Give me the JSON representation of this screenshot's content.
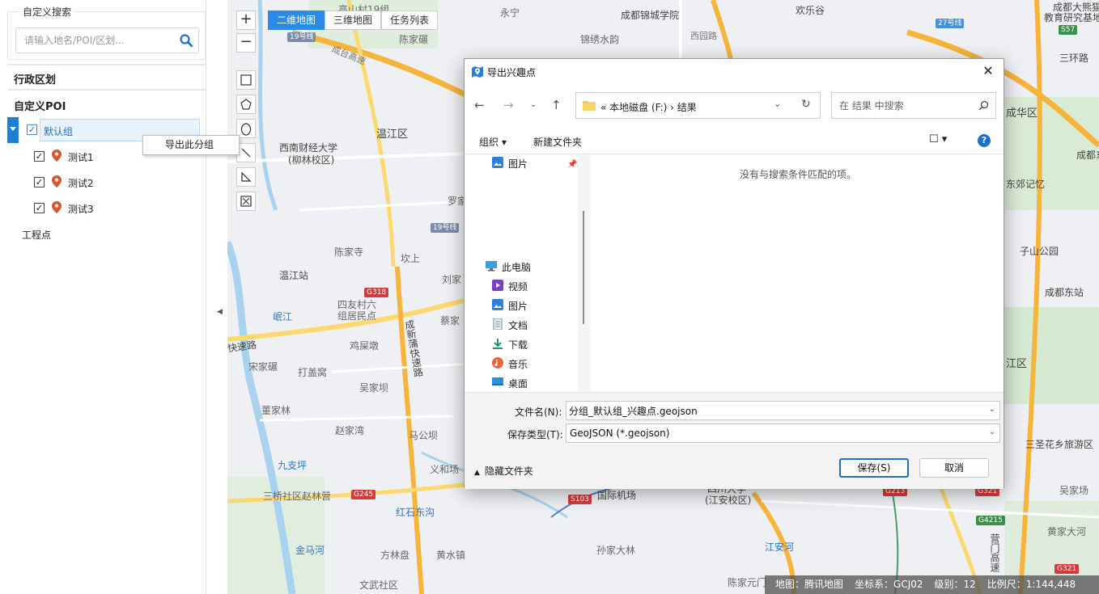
{
  "left_panel": {
    "search_legend": "自定义搜索",
    "search_placeholder": "请输入地名/POI/区划...",
    "section_admin": "行政区划",
    "section_poi": "自定义POI",
    "group_name": "默认组",
    "items": [
      {
        "label": "测试1",
        "checked": true
      },
      {
        "label": "测试2",
        "checked": true
      },
      {
        "label": "测试3",
        "checked": true
      }
    ],
    "project_points": "工程点",
    "context_menu_item": "导出此分组"
  },
  "map": {
    "tabs": [
      "二维地图",
      "三维地图",
      "任务列表"
    ],
    "active_tab": "二维地图",
    "zoom_in": "+",
    "zoom_out": "−",
    "labels": {
      "yongning": "永宁",
      "jinxiu": "锦绣水韵",
      "jinchengxy": "成都锦城学院",
      "huanlegu": "欢乐谷",
      "xiyuan": "西园路",
      "chenjiachang": "陈家碾",
      "gaoshancun": "高山村19组",
      "chenghewai": "成台高速",
      "wenjiangqu": "温江区",
      "xncjdx": "西南财经大学",
      "liulin": "(柳林校区)",
      "luojia": "罗家",
      "chenjiasi": "陈家寺",
      "kanshang": "坎上",
      "wenjiangzhan": "温江站",
      "liujia": "刘家",
      "siyoucun": "四友村六",
      "zujumin": "组居民点",
      "caijia": "蔡家",
      "minjiang": "岷江",
      "kuaisulu": "快速路",
      "cxpkz": "成新蒲快速路",
      "songjia": "宋家碾",
      "dinggai": "打盖窝",
      "jiequan": "鸡屎墩",
      "wujiaba": "吴家坝",
      "dongjialin": "董家林",
      "zhaojiawan": "赵家湾",
      "maogonglin": "马公坝",
      "jiuwenpin": "九支坪",
      "yihegu": "义和场",
      "sanqiao": "三桥社区赵林营",
      "hongshi": "红石东沟",
      "jinmahe": "金马河",
      "fanglinpan": "方林盘",
      "huangshuizhen": "黄水镇",
      "wenjiaoyuan": "文武社区",
      "guojijichang": "国际机场",
      "sunjiadalin": "孙家大林",
      "sichuandaxue": "四川大学",
      "jiangan": "(江安校区)",
      "jianganhe": "江安河",
      "chenjiayuan": "陈家元门",
      "chenghuaqu": "成华区",
      "dongjiaoji": "东郊记忆",
      "chengdudong": "成都东站",
      "zishan": "子山公园",
      "sanhuanlu": "三环路",
      "jinjiang": "江区",
      "sansheng": "三圣花乡旅游区",
      "wujiachang": "吴家场",
      "huangjiadahe": "黄家大河",
      "chengdudt": "成都东",
      "jiaoyu": "教育研究基地",
      "chengdudabai": "成都大熊猫",
      "yingmenkou": "营门高速"
    },
    "shields": [
      "19号线",
      "19号线",
      "27号线",
      "S57",
      "G318",
      "G245",
      "S103",
      "G213",
      "G321",
      "G4215",
      "G321"
    ],
    "status": {
      "map": "地图：腾讯地图",
      "crs": "坐标系：GCJ02",
      "level": "级别：12",
      "scale": "比例尺：1:144,448"
    }
  },
  "dialog": {
    "title": "导出兴趣点",
    "address": "«  本地磁盘 (F:)  ›  结果",
    "search_placeholder": "在 结果 中搜索",
    "organize": "组织 ▾",
    "new_folder": "新建文件夹",
    "help": "?",
    "nav_items": [
      {
        "label": "图片",
        "icon": "pictures-icon"
      },
      {
        "label": "此电脑",
        "icon": "computer-icon"
      },
      {
        "label": "视频",
        "icon": "video-icon"
      },
      {
        "label": "图片",
        "icon": "pictures-icon"
      },
      {
        "label": "文档",
        "icon": "documents-icon"
      },
      {
        "label": "下载",
        "icon": "download-icon"
      },
      {
        "label": "音乐",
        "icon": "music-icon"
      },
      {
        "label": "桌面",
        "icon": "desktop-icon"
      }
    ],
    "empty_message": "没有与搜索条件匹配的项。",
    "filename_label": "文件名(N):",
    "filename_value": "分组_默认组_兴趣点.geojson",
    "filetype_label": "保存类型(T):",
    "filetype_value": "GeoJSON (*.geojson)",
    "hide_folders": "隐藏文件夹",
    "save_button": "保存(S)",
    "cancel_button": "取消",
    "close": "✕"
  },
  "colors": {
    "accent": "#2a8be8",
    "tree_bar": "#1e7fd4",
    "road_orange": "#f7b43b",
    "road_yellow": "#fcd970",
    "water": "#a8d3f0",
    "green": "#cfe8c9",
    "pin_red": "#d9532c"
  }
}
